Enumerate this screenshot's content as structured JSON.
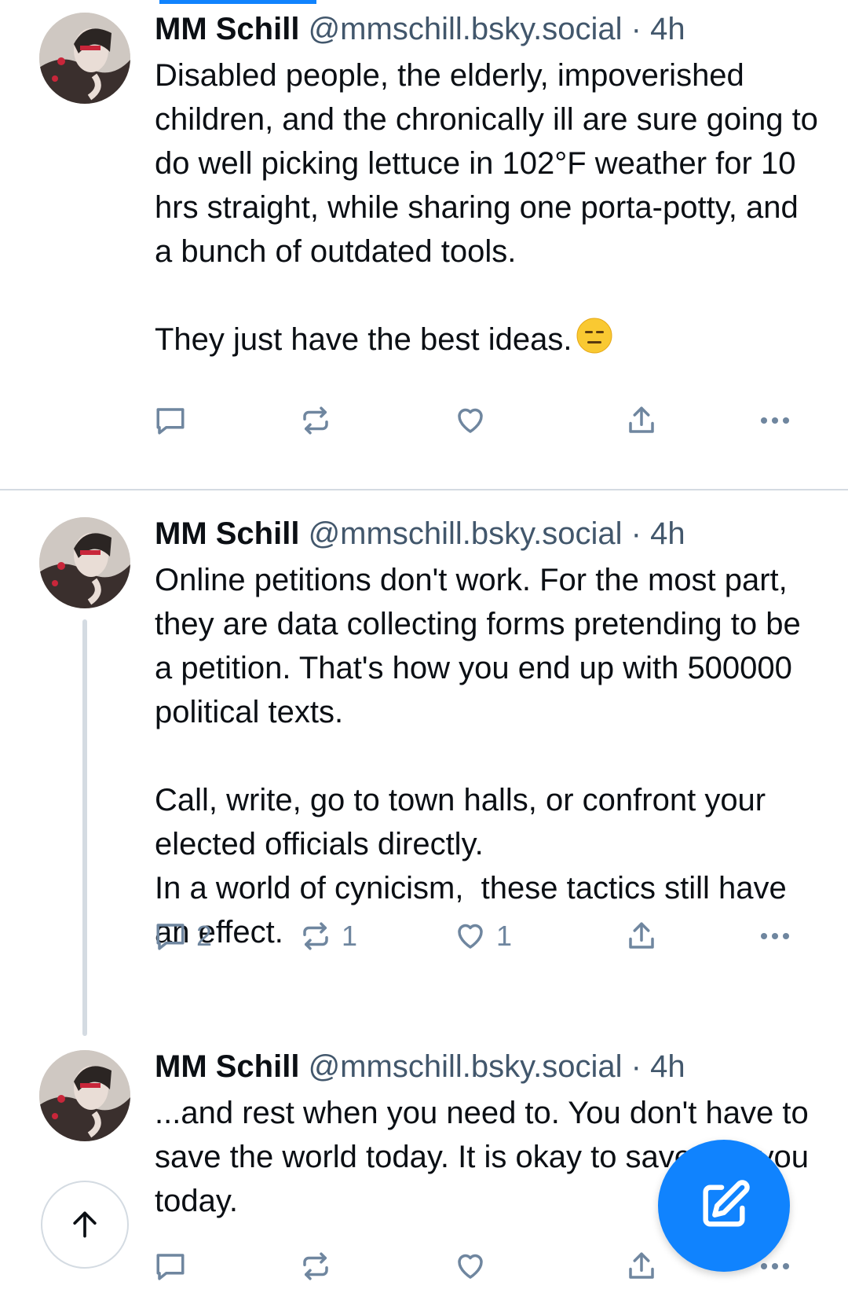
{
  "colors": {
    "accent": "#1083fe",
    "icon_gray": "#6f869f",
    "text_secondary": "#42576c",
    "divider": "#d4dbe2"
  },
  "posts": [
    {
      "author": "MM Schill",
      "handle": "@mmschill.bsky.social",
      "separator": "·",
      "time": "4h",
      "text": "Disabled people, the elderly, impoverished children, and the chronically ill are sure going to do well picking lettuce in 102°F weather for 10 hrs straight, while sharing one porta-potty, and a bunch of outdated tools.\n\nThey just have the best ideas.",
      "emoji": "expressionless-face-emoji",
      "replies": "",
      "reposts": "",
      "likes": ""
    },
    {
      "author": "MM Schill",
      "handle": "@mmschill.bsky.social",
      "separator": "·",
      "time": "4h",
      "text": "Online petitions don't work. For the most part, they are data collecting forms pretending to be a petition. That's how you end up with 500000 political texts.\n\nCall, write, go to town halls, or confront your elected officials directly.\nIn a world of cynicism,  these tactics still have an effect.",
      "replies": "2",
      "reposts": "1",
      "likes": "1"
    },
    {
      "author": "MM Schill",
      "handle": "@mmschill.bsky.social",
      "separator": "·",
      "time": "4h",
      "text": "...and rest when you need to. You don't have to save the world today. It is okay to save just you today.",
      "replies": "",
      "reposts": "",
      "likes": ""
    }
  ],
  "icons": {
    "reply": "reply-icon",
    "repost": "repost-icon",
    "like": "heart-icon",
    "share": "share-icon",
    "more": "more-icon",
    "scroll_top": "arrow-up-icon",
    "compose": "compose-icon"
  }
}
